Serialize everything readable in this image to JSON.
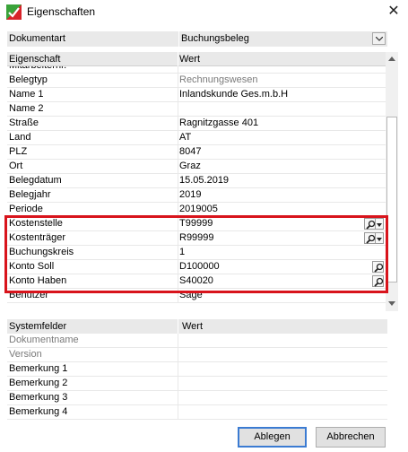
{
  "window": {
    "title": "Eigenschaften",
    "close_glyph": "✕"
  },
  "doctype": {
    "label": "Dokumentart",
    "value": "Buchungsbeleg"
  },
  "properties": {
    "col_name": "Eigenschaft",
    "col_value": "Wert",
    "rows": [
      {
        "name": "Mitarbeiternr.",
        "value": ""
      },
      {
        "name": "Belegtyp",
        "value": "Rechnungswesen",
        "value_grey": true
      },
      {
        "name": "Name 1",
        "value": "Inlandskunde Ges.m.b.H"
      },
      {
        "name": "Name 2",
        "value": ""
      },
      {
        "name": "Straße",
        "value": "Ragnitzgasse 401"
      },
      {
        "name": "Land",
        "value": "AT"
      },
      {
        "name": "PLZ",
        "value": "8047"
      },
      {
        "name": "Ort",
        "value": "Graz"
      },
      {
        "name": "Belegdatum",
        "value": "15.05.2019"
      },
      {
        "name": "Belegjahr",
        "value": "2019"
      },
      {
        "name": "Periode",
        "value": "2019005"
      },
      {
        "name": "Kostenstelle",
        "value": "T99999",
        "lookup": "search-dropdown"
      },
      {
        "name": "Kostenträger",
        "value": "R99999",
        "lookup": "search-dropdown"
      },
      {
        "name": "Buchungskreis",
        "value": "1"
      },
      {
        "name": "Konto Soll",
        "value": "D100000",
        "lookup": "search"
      },
      {
        "name": "Konto Haben",
        "value": "S40020",
        "lookup": "search"
      },
      {
        "name": "Benutzer",
        "value": "Sage"
      }
    ]
  },
  "system_fields": {
    "col_name": "Systemfelder",
    "col_value": "Wert",
    "rows": [
      {
        "name": "Dokumentname",
        "value": "",
        "grey": true
      },
      {
        "name": "Version",
        "value": "",
        "grey": true
      },
      {
        "name": "Bemerkung 1",
        "value": ""
      },
      {
        "name": "Bemerkung 2",
        "value": ""
      },
      {
        "name": "Bemerkung 3",
        "value": ""
      },
      {
        "name": "Bemerkung 4",
        "value": ""
      }
    ]
  },
  "buttons": {
    "ok": "Ablegen",
    "cancel": "Abbrechen"
  },
  "colors": {
    "highlight": "#d8141c",
    "default_button_border": "#3b7bd2",
    "app_icon_green": "#3aa33a",
    "app_icon_red": "#d8232a"
  },
  "icons": {
    "app": "app-logo-icon",
    "close": "close-icon",
    "dropdown": "chevron-down-icon",
    "lookup": "magnifier-icon",
    "scroll_up": "scroll-up-icon",
    "scroll_down": "scroll-down-icon"
  }
}
